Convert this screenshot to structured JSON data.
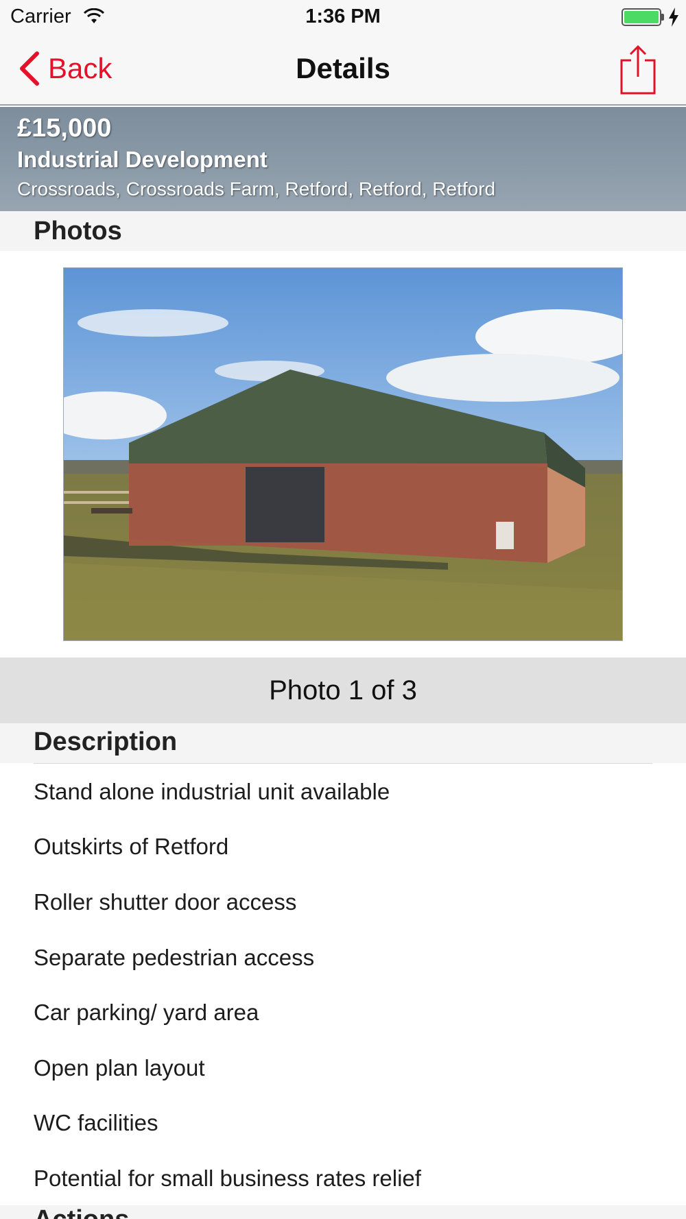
{
  "status_bar": {
    "carrier": "Carrier",
    "time": "1:36 PM",
    "wifi_icon": "wifi-icon",
    "battery_icon": "battery-icon",
    "charging_icon": "bolt-icon"
  },
  "nav": {
    "back_label": "Back",
    "title": "Details",
    "share_icon": "share-icon",
    "accent_color": "#e3122a"
  },
  "listing": {
    "price": "£15,000",
    "type": "Industrial Development",
    "address": "Crossroads, Crossroads Farm, Retford, Retford, Retford"
  },
  "photos": {
    "section_title": "Photos",
    "caption": "Photo 1 of 3"
  },
  "description": {
    "section_title": "Description",
    "items": [
      "Stand alone industrial unit available",
      "Outskirts of Retford",
      "Roller shutter door access",
      "Separate pedestrian access",
      "Car parking/ yard area",
      "Open plan layout",
      "WC facilities",
      "Potential for small business rates relief"
    ]
  },
  "next_section": {
    "title": "Actions"
  }
}
